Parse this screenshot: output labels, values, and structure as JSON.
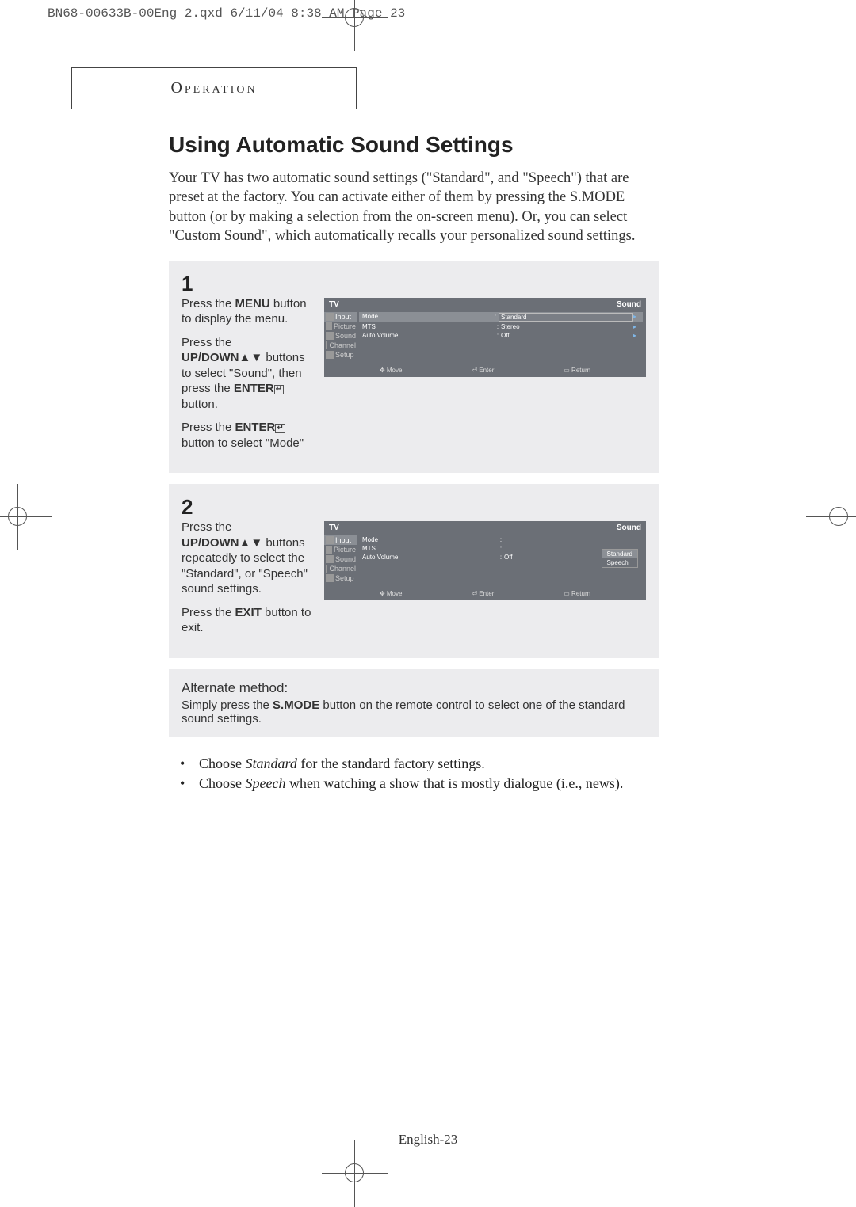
{
  "print_header": "BN68-00633B-00Eng 2.qxd  6/11/04 8:38 AM  Page 23",
  "section_label": "Operation",
  "title": "Using Automatic Sound Settings",
  "intro": "Your TV has two automatic sound settings (\"Standard\", and \"Speech\") that are preset at the factory. You can activate either of them by pressing the S.MODE button (or by making a selection from the on-screen menu). Or, you can select \"Custom Sound\", which automatically recalls your personalized sound settings.",
  "steps": [
    {
      "num": "1",
      "para1_a": "Press the ",
      "para1_b": "MENU",
      "para1_c": " button to display the menu.",
      "para2_a": "Press the ",
      "para2_b": "UP/DOWN",
      "para2_c": " buttons to select \"Sound\", then press the ",
      "para2_d": "ENTER",
      "para2_e": " button.",
      "para3_a": "Press the ",
      "para3_b": "ENTER",
      "para3_c": " button to select \"Mode\"",
      "osd": {
        "tv": "TV",
        "title": "Sound",
        "left": [
          "Input",
          "Picture",
          "Sound",
          "Channel",
          "Setup"
        ],
        "sel": 0,
        "rows": [
          {
            "k": "Mode",
            "v": "Standard",
            "boxed": true,
            "arrow": "▸"
          },
          {
            "k": "MTS",
            "v": "Stereo",
            "arrow": "▸"
          },
          {
            "k": "Auto Volume",
            "v": "Off",
            "arrow": "▸"
          }
        ],
        "foot": [
          "Move",
          "Enter",
          "Return"
        ]
      }
    },
    {
      "num": "2",
      "para1_a": "Press the ",
      "para1_b": "UP/DOWN",
      "para1_c": " buttons repeatedly to select the \"Standard\", or \"Speech\" sound settings.",
      "para2_a": "Press the ",
      "para2_b": "EXIT",
      "para2_c": " button to exit.",
      "osd": {
        "tv": "TV",
        "title": "Sound",
        "left": [
          "Input",
          "Picture",
          "Sound",
          "Channel",
          "Setup"
        ],
        "sel": 0,
        "rows": [
          {
            "k": "Mode",
            "v": "",
            "arrow": ""
          },
          {
            "k": "MTS",
            "v": "",
            "arrow": ""
          },
          {
            "k": "Auto Volume",
            "v": "Off",
            "arrow": ""
          }
        ],
        "dropdown": [
          "Standard",
          "Speech"
        ],
        "dropdown_sel": 0,
        "foot": [
          "Move",
          "Enter",
          "Return"
        ]
      }
    }
  ],
  "alternate": {
    "hdr": "Alternate method:",
    "body_a": "Simply press the ",
    "body_b": "S.MODE",
    "body_c": " button on the remote control to select one of the standard sound settings."
  },
  "bullets": [
    {
      "pre": "Choose ",
      "em": "Standard",
      "post": " for the standard factory settings."
    },
    {
      "pre": "Choose ",
      "em": "Speech",
      "post": " when watching a show that is mostly dialogue (i.e., news)."
    }
  ],
  "page_footer": "English-23",
  "glyphs": {
    "updown": "▲▼",
    "enter": "↵",
    "move": "✥",
    "enter_btn": "⏎",
    "return": "▭"
  }
}
